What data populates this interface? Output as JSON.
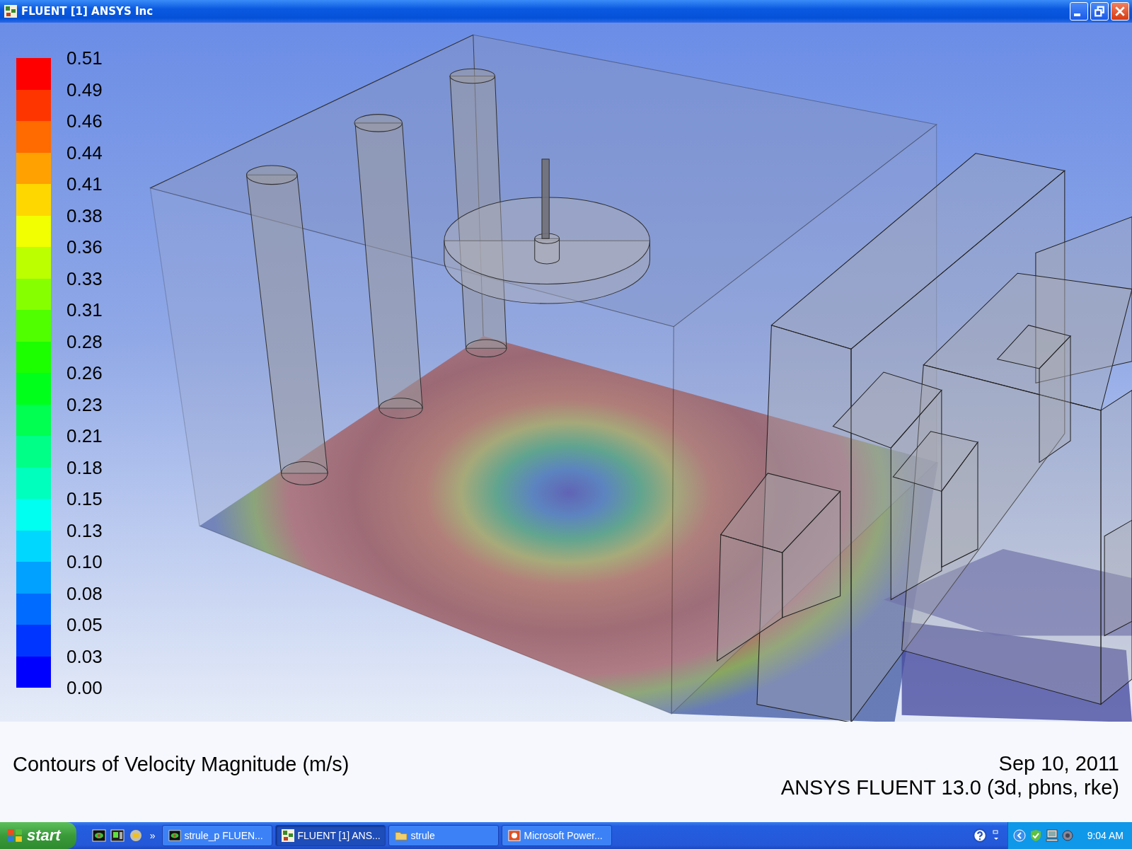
{
  "window": {
    "title": "FLUENT [1] ANSYS Inc"
  },
  "legend": {
    "labels": [
      "0.51",
      "0.49",
      "0.46",
      "0.44",
      "0.41",
      "0.38",
      "0.36",
      "0.33",
      "0.31",
      "0.28",
      "0.26",
      "0.23",
      "0.21",
      "0.18",
      "0.15",
      "0.13",
      "0.10",
      "0.08",
      "0.05",
      "0.03",
      "0.00"
    ],
    "bands": [
      {
        "color": "#ff0000"
      },
      {
        "color": "#ff3500"
      },
      {
        "color": "#ff6b00"
      },
      {
        "color": "#ffa100"
      },
      {
        "color": "#ffd700"
      },
      {
        "color": "#f1ff00"
      },
      {
        "color": "#bcff00"
      },
      {
        "color": "#86ff00"
      },
      {
        "color": "#50ff00"
      },
      {
        "color": "#1bff00"
      },
      {
        "color": "#00ff1b"
      },
      {
        "color": "#00ff50"
      },
      {
        "color": "#00ff86"
      },
      {
        "color": "#00ffbc"
      },
      {
        "color": "#00fff1"
      },
      {
        "color": "#00d7ff"
      },
      {
        "color": "#00a1ff"
      },
      {
        "color": "#006bff"
      },
      {
        "color": "#0035ff"
      },
      {
        "color": "#0000ff"
      }
    ]
  },
  "caption": {
    "title": "Contours of Velocity Magnitude (m/s)",
    "date": "Sep 10, 2011",
    "version": "ANSYS FLUENT 13.0 (3d, pbns, rke)"
  },
  "taskbar": {
    "start": "start",
    "quick_launch_more": "»",
    "tasks": [
      {
        "label": "strule_p FLUEN...",
        "selected": false,
        "kind": "graphics"
      },
      {
        "label": "FLUENT [1] ANS...",
        "selected": true,
        "kind": "fluent"
      },
      {
        "label": "strule",
        "selected": false,
        "kind": "folder"
      },
      {
        "label": "Microsoft Power...",
        "selected": false,
        "kind": "powerpoint"
      }
    ],
    "clock": "9:04 AM"
  }
}
